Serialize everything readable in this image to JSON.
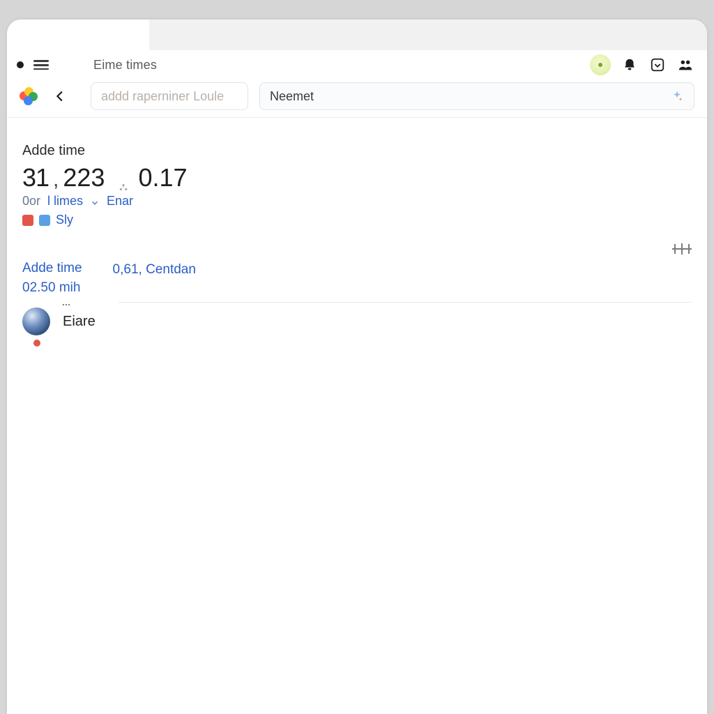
{
  "header": {
    "page_title": "Eime times"
  },
  "search": {
    "field1_placeholder": "addd raperniner Loule",
    "field2_value": "Neemet"
  },
  "summary": {
    "heading": "Adde time",
    "num_a": "31",
    "num_b": "223",
    "num_c": "0.17",
    "sub_left": "0or",
    "sub_mid": "l limes",
    "sub_action": "Enar",
    "sly_label": "Sly"
  },
  "section2": {
    "col_a_1": "Adde time",
    "col_a_2": "02.50 mih",
    "col_b": "0,61, Centdan"
  },
  "list": {
    "item_label": "Eiare"
  }
}
